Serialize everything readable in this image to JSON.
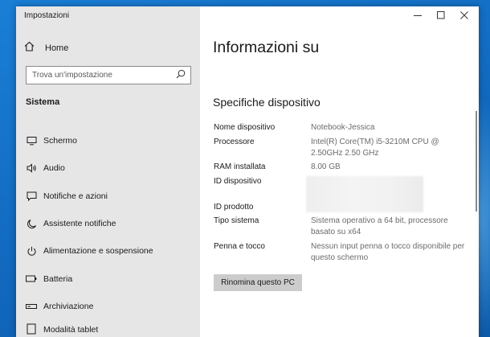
{
  "window": {
    "title": "Impostazioni"
  },
  "sidebar": {
    "home_label": "Home",
    "search_placeholder": "Trova un'impostazione",
    "section_title": "Sistema",
    "items": [
      {
        "icon": "monitor-icon",
        "label": "Schermo"
      },
      {
        "icon": "speaker-icon",
        "label": "Audio"
      },
      {
        "icon": "notification-icon",
        "label": "Notifiche e azioni"
      },
      {
        "icon": "moon-icon",
        "label": "Assistente notifiche"
      },
      {
        "icon": "power-icon",
        "label": "Alimentazione e sospensione"
      },
      {
        "icon": "battery-icon",
        "label": "Batteria"
      },
      {
        "icon": "storage-icon",
        "label": "Archiviazione"
      },
      {
        "icon": "tablet-icon",
        "label": "Modalità tablet"
      }
    ]
  },
  "main": {
    "title": "Informazioni su",
    "section_title": "Specifiche dispositivo",
    "specs": [
      {
        "key": "Nome dispositivo",
        "value": "Notebook-Jessica"
      },
      {
        "key": "Processore",
        "value": "Intel(R) Core(TM) i5-3210M CPU @ 2.50GHz   2.50 GHz"
      },
      {
        "key": "RAM installata",
        "value": "8.00 GB"
      },
      {
        "key": "ID dispositivo",
        "value": ""
      },
      {
        "key": "ID prodotto",
        "value": ""
      },
      {
        "key": "Tipo sistema",
        "value": "Sistema operativo a 64 bit, processore basato su x64"
      },
      {
        "key": "Penna e tocco",
        "value": "Nessun input penna o tocco disponibile per questo schermo"
      }
    ],
    "rename_button": "Rinomina questo PC"
  }
}
